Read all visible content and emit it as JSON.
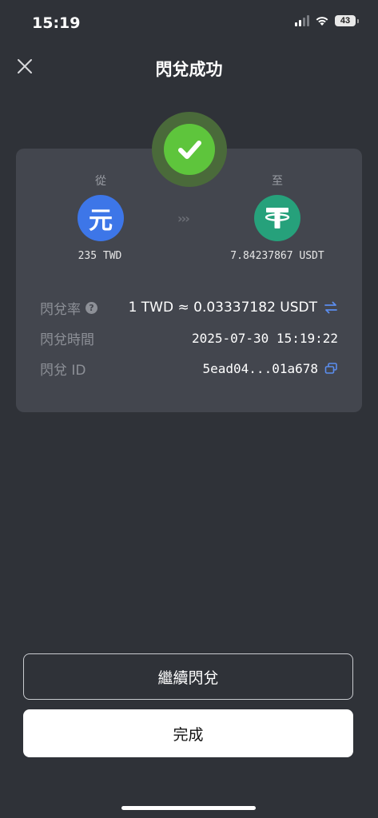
{
  "status_bar": {
    "time": "15:19",
    "battery": "43"
  },
  "nav": {
    "title": "閃兌成功",
    "close_icon": "close-icon"
  },
  "from": {
    "label": "從",
    "coin_glyph": "元",
    "amount": "235 TWD"
  },
  "to": {
    "label": "至",
    "coin_glyph": "T",
    "amount": "7.84237867 USDT"
  },
  "details": {
    "rate_label": "閃兌率",
    "rate_value": "1 TWD ≈ 0.03337182 USDT",
    "time_label": "閃兌時間",
    "time_value": "2025-07-30 15:19:22",
    "id_label": "閃兌 ID",
    "id_value": "5ead04...01a678"
  },
  "buttons": {
    "continue_label": "繼續閃兌",
    "done_label": "完成"
  },
  "colors": {
    "success": "#5ec53c",
    "accent": "#5b8dee",
    "twd_coin": "#3d76e8",
    "usdt_coin": "#26a17b",
    "background": "#2f3238",
    "card": "#43464e"
  }
}
